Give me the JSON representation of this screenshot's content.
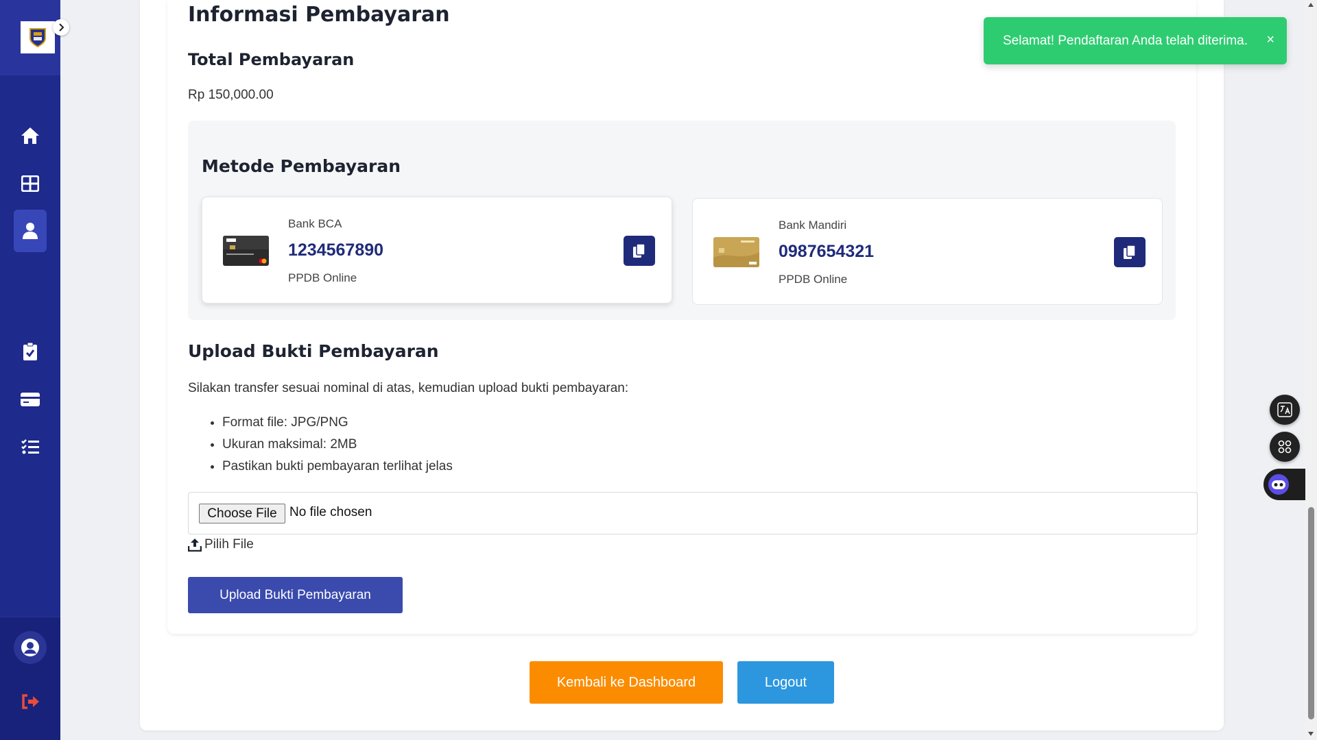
{
  "colors": {
    "sidebar": "#1e2a8c",
    "primary_dark": "#1f2b7a",
    "upload_button": "#3a4aad",
    "dashboard_button": "#fb8c00",
    "logout_button": "#2c97de",
    "toast": "#2ecc71",
    "logout_icon": "#e74c3c"
  },
  "sidebar": {
    "icons": [
      "home-icon",
      "grid-icon",
      "user-icon",
      "clipboard-check-icon",
      "credit-card-icon",
      "checklist-icon"
    ],
    "active_item": "user-icon",
    "bottom_icons": [
      "account-circle-icon",
      "sign-out-icon"
    ]
  },
  "payment": {
    "title": "Informasi Pembayaran",
    "total_title": "Total Pembayaran",
    "total_amount": "Rp 150,000.00",
    "method_title": "Metode Pembayaran",
    "banks": [
      {
        "name": "Bank BCA",
        "account": "1234567890",
        "holder": "PPDB Online"
      },
      {
        "name": "Bank Mandiri",
        "account": "0987654321",
        "holder": "PPDB Online"
      }
    ]
  },
  "upload": {
    "title": "Upload Bukti Pembayaran",
    "description": "Silakan transfer sesuai nominal di atas, kemudian upload bukti pembayaran:",
    "requirements": [
      "Format file: JPG/PNG",
      "Ukuran maksimal: 2MB",
      "Pastikan bukti pembayaran terlihat jelas"
    ],
    "choose_file": "Choose File",
    "no_file": "No file chosen",
    "pick_file": "Pilih File",
    "submit": "Upload Bukti Pembayaran"
  },
  "actions": {
    "dashboard": "Kembali ke Dashboard",
    "logout": "Logout"
  },
  "toast": {
    "message": "Selamat! Pendaftaran Anda telah diterima.",
    "close": "×"
  }
}
